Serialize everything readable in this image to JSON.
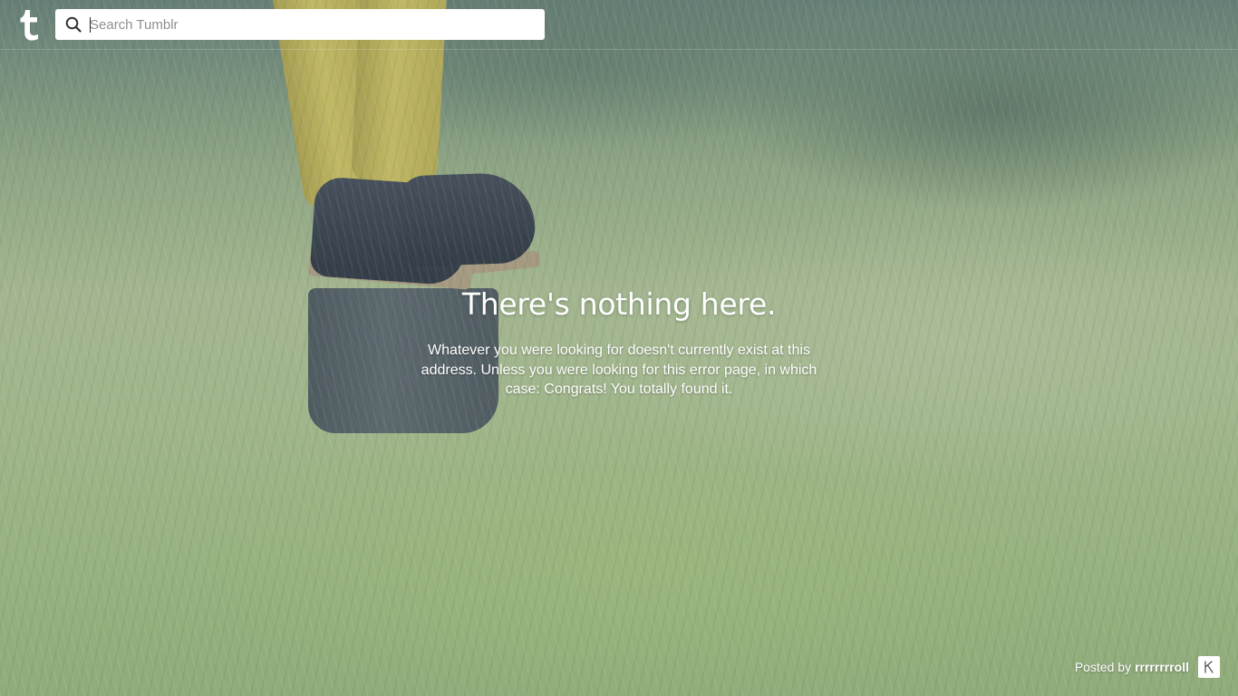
{
  "header": {
    "logo_letter": "t",
    "search": {
      "placeholder": "Search Tumblr",
      "value": ""
    }
  },
  "message": {
    "title": "There's nothing here.",
    "body": "Whatever you were looking for doesn't currently exist at this address. Unless you were looking for this error page, in which case: Congrats! You totally found it."
  },
  "credit": {
    "prefix": "Posted by",
    "author": "rrrrrrrroll"
  },
  "colors": {
    "text": "#ffffff",
    "search_bg": "#ffffff",
    "placeholder": "#8f8f8f"
  },
  "icons": {
    "logo": "tumblr-logo-icon",
    "search": "search-icon",
    "avatar": "author-avatar-icon"
  }
}
